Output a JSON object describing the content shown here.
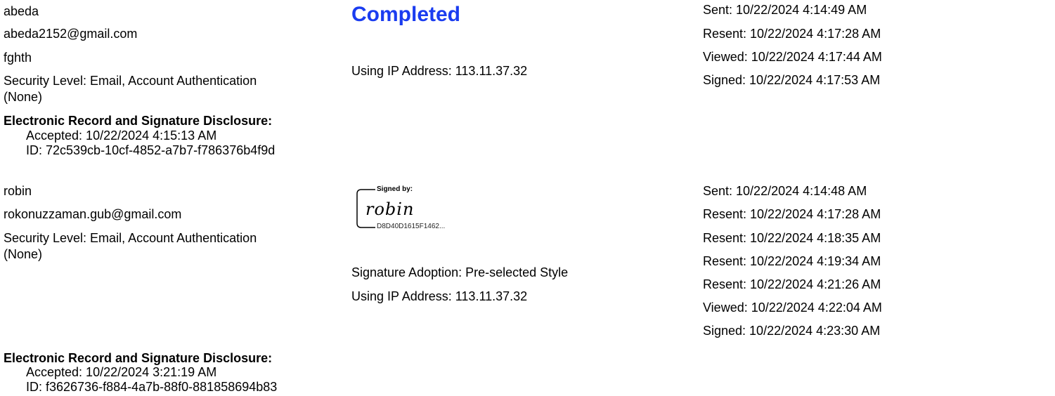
{
  "signer1": {
    "name": "abeda",
    "email": "abeda2152@gmail.com",
    "title": "fghth",
    "security_line1": "Security Level: Email, Account Authentication",
    "security_line2": "(None)",
    "status": "Completed",
    "ip": "Using IP Address: 113.11.37.32",
    "disclosure_heading": "Electronic Record and Signature Disclosure:",
    "disclosure_accepted": "Accepted: 10/22/2024 4:15:13 AM",
    "disclosure_id": "ID: 72c539cb-10cf-4852-a7b7-f786376b4f9d",
    "events": [
      "Sent: 10/22/2024 4:14:49 AM",
      "Resent: 10/22/2024 4:17:28 AM",
      "Viewed: 10/22/2024 4:17:44 AM",
      "Signed: 10/22/2024 4:17:53 AM"
    ]
  },
  "signer2": {
    "name": "robin",
    "email": "rokonuzzaman.gub@gmail.com",
    "security_line1": "Security Level: Email, Account Authentication",
    "security_line2": "(None)",
    "signature": {
      "label": "Signed by:",
      "name": "robin",
      "hash": "D8D40D1615F1462..."
    },
    "adoption": "Signature Adoption: Pre-selected Style",
    "ip": "Using IP Address: 113.11.37.32",
    "disclosure_heading": "Electronic Record and Signature Disclosure:",
    "disclosure_accepted": "Accepted: 10/22/2024 3:21:19 AM",
    "disclosure_id": "ID: f3626736-f884-4a7b-88f0-881858694b83",
    "events": [
      "Sent: 10/22/2024 4:14:48 AM",
      "Resent: 10/22/2024 4:17:28 AM",
      "Resent: 10/22/2024 4:18:35 AM",
      "Resent: 10/22/2024 4:19:34 AM",
      "Resent: 10/22/2024 4:21:26 AM",
      "Viewed: 10/22/2024 4:22:04 AM",
      "Signed: 10/22/2024 4:23:30 AM"
    ]
  }
}
